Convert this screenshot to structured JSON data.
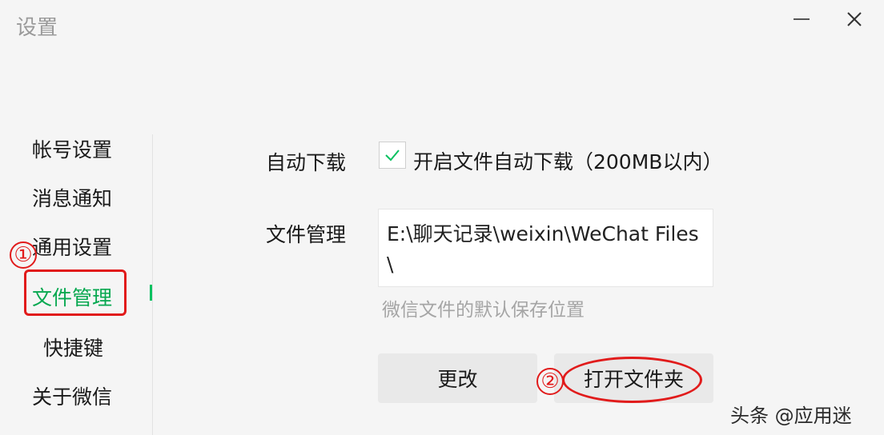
{
  "window": {
    "title": "设置"
  },
  "nav": {
    "items": [
      {
        "label": "帐号设置"
      },
      {
        "label": "消息通知"
      },
      {
        "label": "通用设置"
      },
      {
        "label": "文件管理"
      },
      {
        "label": "快捷键"
      },
      {
        "label": "关于微信"
      }
    ],
    "active_index": 3
  },
  "settings": {
    "auto_download": {
      "label": "自动下载",
      "checkbox_checked": true,
      "checkbox_label": "开启文件自动下载（200MB以内）"
    },
    "file_management": {
      "label": "文件管理",
      "path": "E:\\聊天记录\\weixin\\WeChat Files\\",
      "hint": "微信文件的默认保存位置"
    },
    "buttons": {
      "change": "更改",
      "open_folder": "打开文件夹"
    }
  },
  "annotations": {
    "step1": "①",
    "step2": "②",
    "color": "#e11b1b"
  },
  "watermark": "头条 @应用迷",
  "colors": {
    "accent": "#07c160",
    "active_text": "#07a850"
  },
  "icons": {
    "minimize": "minimize-icon",
    "close": "close-icon",
    "check": "check-icon"
  }
}
